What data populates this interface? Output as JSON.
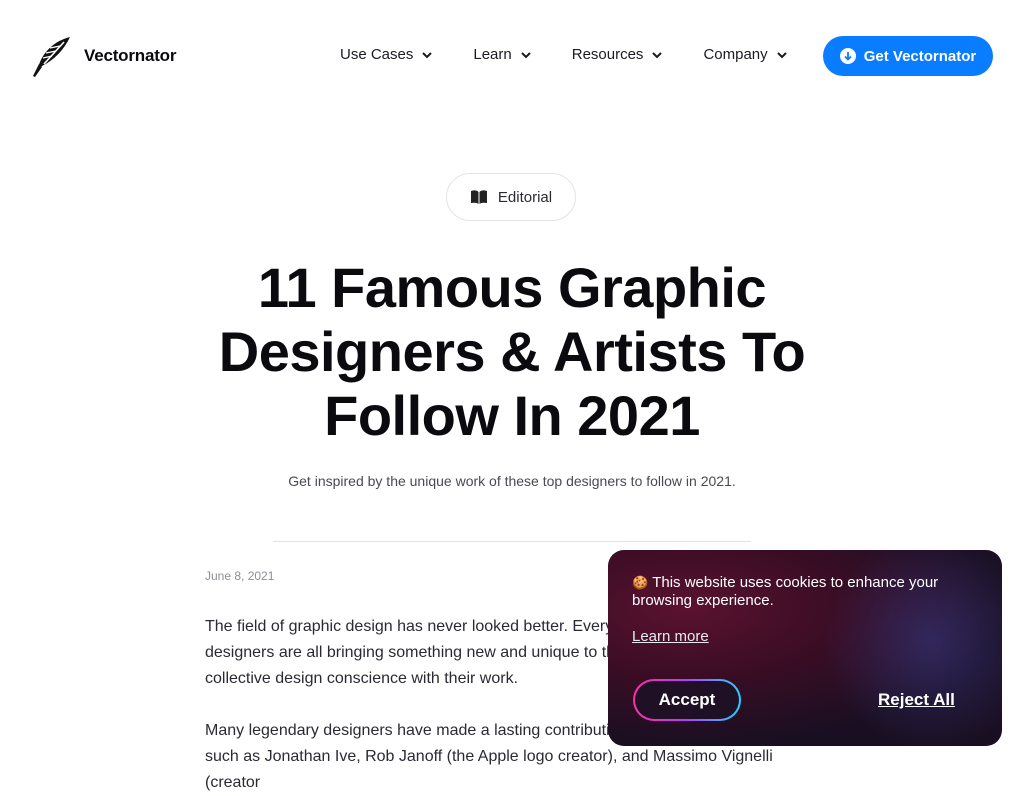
{
  "header": {
    "brand_name": "Vectornator",
    "logo_icon": "quill-pen-icon",
    "nav": [
      {
        "label": "Use Cases"
      },
      {
        "label": "Learn"
      },
      {
        "label": "Resources"
      },
      {
        "label": "Company"
      }
    ],
    "cta_label": "Get Vectornator",
    "cta_icon": "download-circle-icon",
    "accent_color": "#0a7cff"
  },
  "article": {
    "category": "Editorial",
    "category_icon": "open-book-icon",
    "title": "11 Famous Graphic Designers & Artists To Follow In 2021",
    "subtitle": "Get inspired by the unique work of these top designers to follow in 2021.",
    "date": "June 8, 2021",
    "paragraph1": "The field of graphic design has never looked better. Everyone from illustrators to designers are all bringing something new and unique to the table, and improving the collective design conscience with their work.",
    "paragraph2": "Many legendary designers have made a lasting contribution to the world of design, such as Jonathan Ive, Rob Janoff (the Apple logo creator), and Massimo Vignelli (creator"
  },
  "cookie_banner": {
    "emoji": "🍪",
    "message": "This website uses cookies to enhance your browsing experience.",
    "learn_more": "Learn more",
    "accept_label": "Accept",
    "reject_label": "Reject All"
  }
}
